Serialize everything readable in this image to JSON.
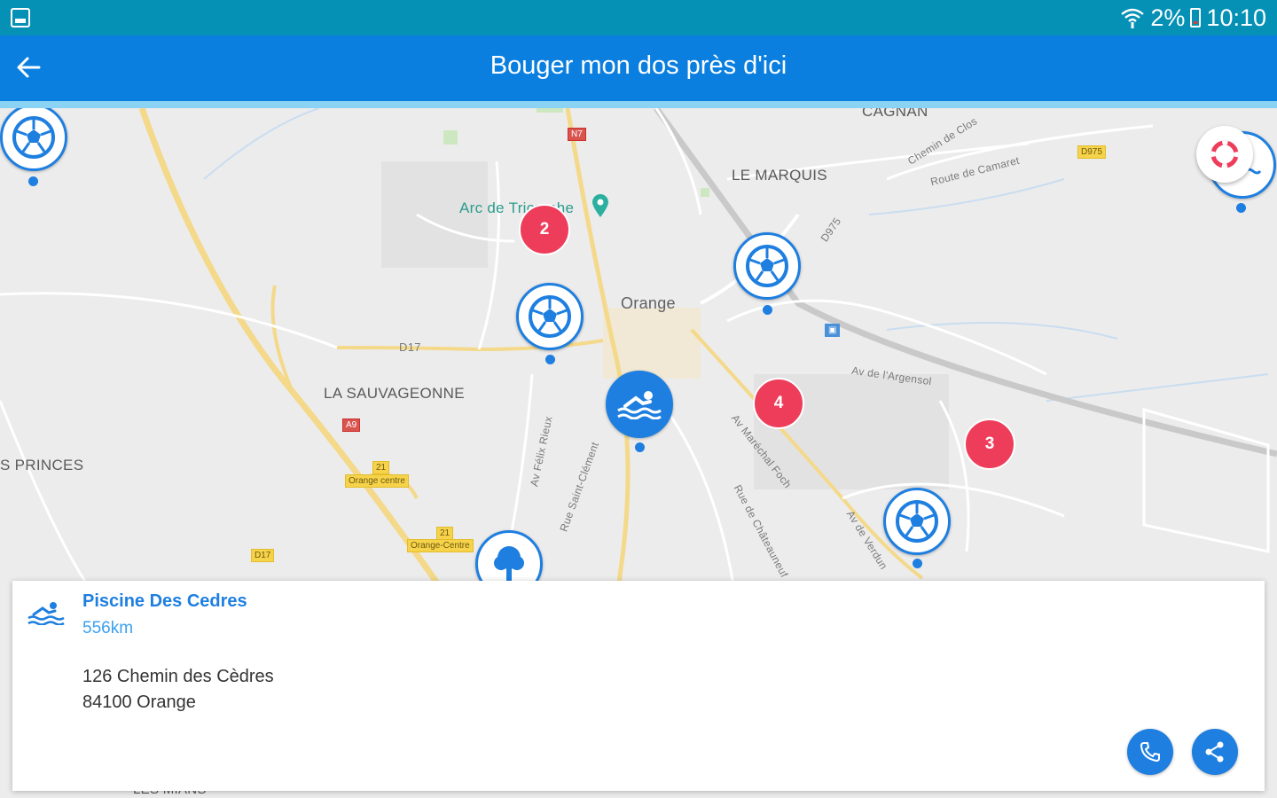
{
  "status_bar": {
    "battery": "2%",
    "time": "10:10"
  },
  "app_bar": {
    "title": "Bouger mon dos près d'ici",
    "icons": {
      "back": "arrow-left-icon"
    }
  },
  "map": {
    "labels": {
      "cagnan": "CAGNAN",
      "le_marquis": "LE MARQUIS",
      "orange": "Orange",
      "arc": "Arc de Triomphe",
      "la_sauvageonne": "LA SAUVAGEONNE",
      "princes": "S PRINCES",
      "d17": "D17",
      "chemin_clos": "Chemin de Clos",
      "route_camaret": "Route de Camaret",
      "d975": "D975",
      "av_argensol": "Av de l'Argensol",
      "av_foch": "Av Maréchal Foch",
      "av_felix": "Av Félix Rieux",
      "rue_st_clement": "Rue Saint-Clément",
      "rue_chateauneuf": "Rue de Châteauneuf",
      "av_verdun": "Av de Verdun",
      "les_mians": "LES MIANS"
    },
    "road_tags": {
      "n7": "N7",
      "d975": "D975",
      "a9": "A9",
      "exit21a": "21",
      "exit21a_name": "Orange centre",
      "exit21b": "21",
      "exit21b_name": "Orange-Centre",
      "d17": "D17"
    },
    "clusters": {
      "c2": "2",
      "c4": "4",
      "c3": "3"
    },
    "marker_icons": {
      "football": "football-icon",
      "swimming": "swimming-icon",
      "tree": "tree-icon",
      "lifebuoy": "lifebuoy-icon"
    }
  },
  "card": {
    "title": "Piscine Des Cedres",
    "distance": "556km",
    "address_line1": "126 Chemin des Cèdres",
    "address_line2": "84100 Orange",
    "icons": {
      "activity": "swimming-icon",
      "phone": "phone-icon",
      "share": "share-icon"
    }
  },
  "colors": {
    "status_bar": "#0591b5",
    "app_bar": "#0a7fe0",
    "marker_blue": "#1e7fe0",
    "cluster_red": "#ee3d5a"
  }
}
